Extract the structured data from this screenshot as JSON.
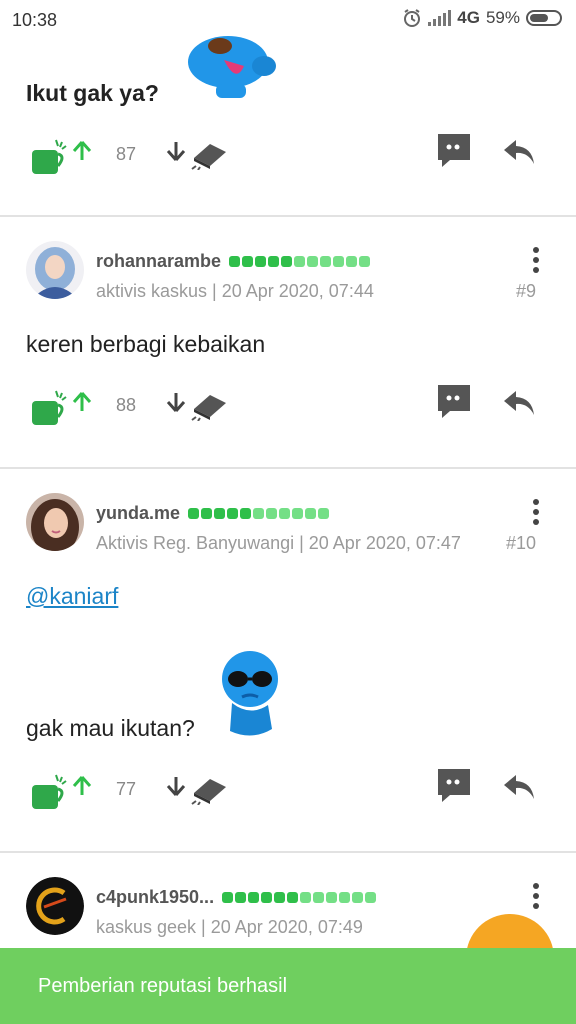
{
  "status": {
    "time": "10:38",
    "network": "4G",
    "battery": "59%"
  },
  "posts": [
    {
      "text": "Ikut gak ya?",
      "votes": "87",
      "emoticon": "blue-mascot-tongue"
    },
    {
      "username": "rohannarambe",
      "meta": "aktivis kaskus | 20 Apr 2020, 07:44",
      "number": "#9",
      "text": "keren berbagi kebaikan",
      "votes": "88"
    },
    {
      "username": "yunda.me",
      "meta": "Aktivis Reg. Banyuwangi | 20 Apr 2020, 07:47",
      "number": "#10",
      "mention": "@kaniarf",
      "text": "gak mau ikutan?",
      "votes": "77",
      "emoticon": "blue-mascot-sunglasses"
    },
    {
      "username": "c4punk1950...",
      "meta": "kaskus geek | 20 Apr 2020, 07:49"
    }
  ],
  "toast": {
    "message": "Pemberian reputasi berhasil"
  },
  "colors": {
    "accent_green": "#2fbf4a",
    "toast_bg": "#6fcf5f",
    "fab": "#f5a623",
    "link": "#1b84c7"
  }
}
